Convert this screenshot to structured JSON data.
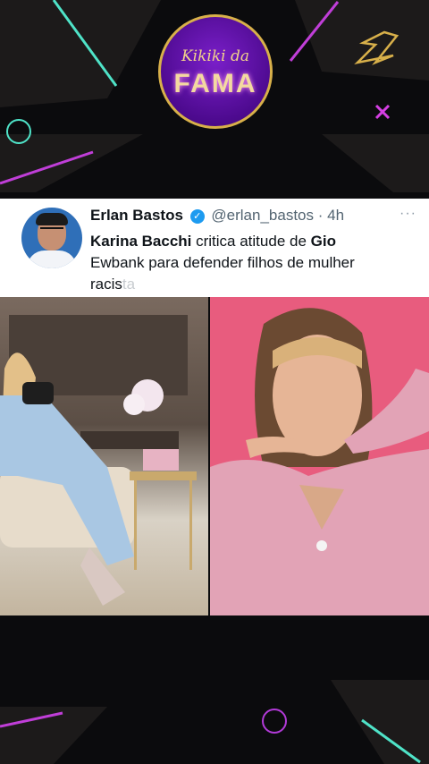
{
  "brand": {
    "logo_top": "Kikiki da",
    "logo_main": "FAMA"
  },
  "tweet": {
    "name": "Erlan Bastos",
    "handle": "@erlan_bastos",
    "separator": "·",
    "time": "4h",
    "more": "···",
    "text_bold_1": "Karina Bacchi",
    "text_1": " critica atitude de ",
    "text_bold_2": "Gio",
    "text_2": "Ewbank para defender filhos de mulher",
    "text_3": "racis",
    "text_3_faded": "ta"
  },
  "colors": {
    "background": "#0b0b0d",
    "logo_purple": "#4d0a8f",
    "gold": "#d8b04a",
    "twitter_blue": "#1d9bf0",
    "pink_bg": "#e85c7e"
  },
  "icons": {
    "verified": "verified-badge-icon",
    "lightning": "lightning-icon",
    "close": "x-icon"
  }
}
